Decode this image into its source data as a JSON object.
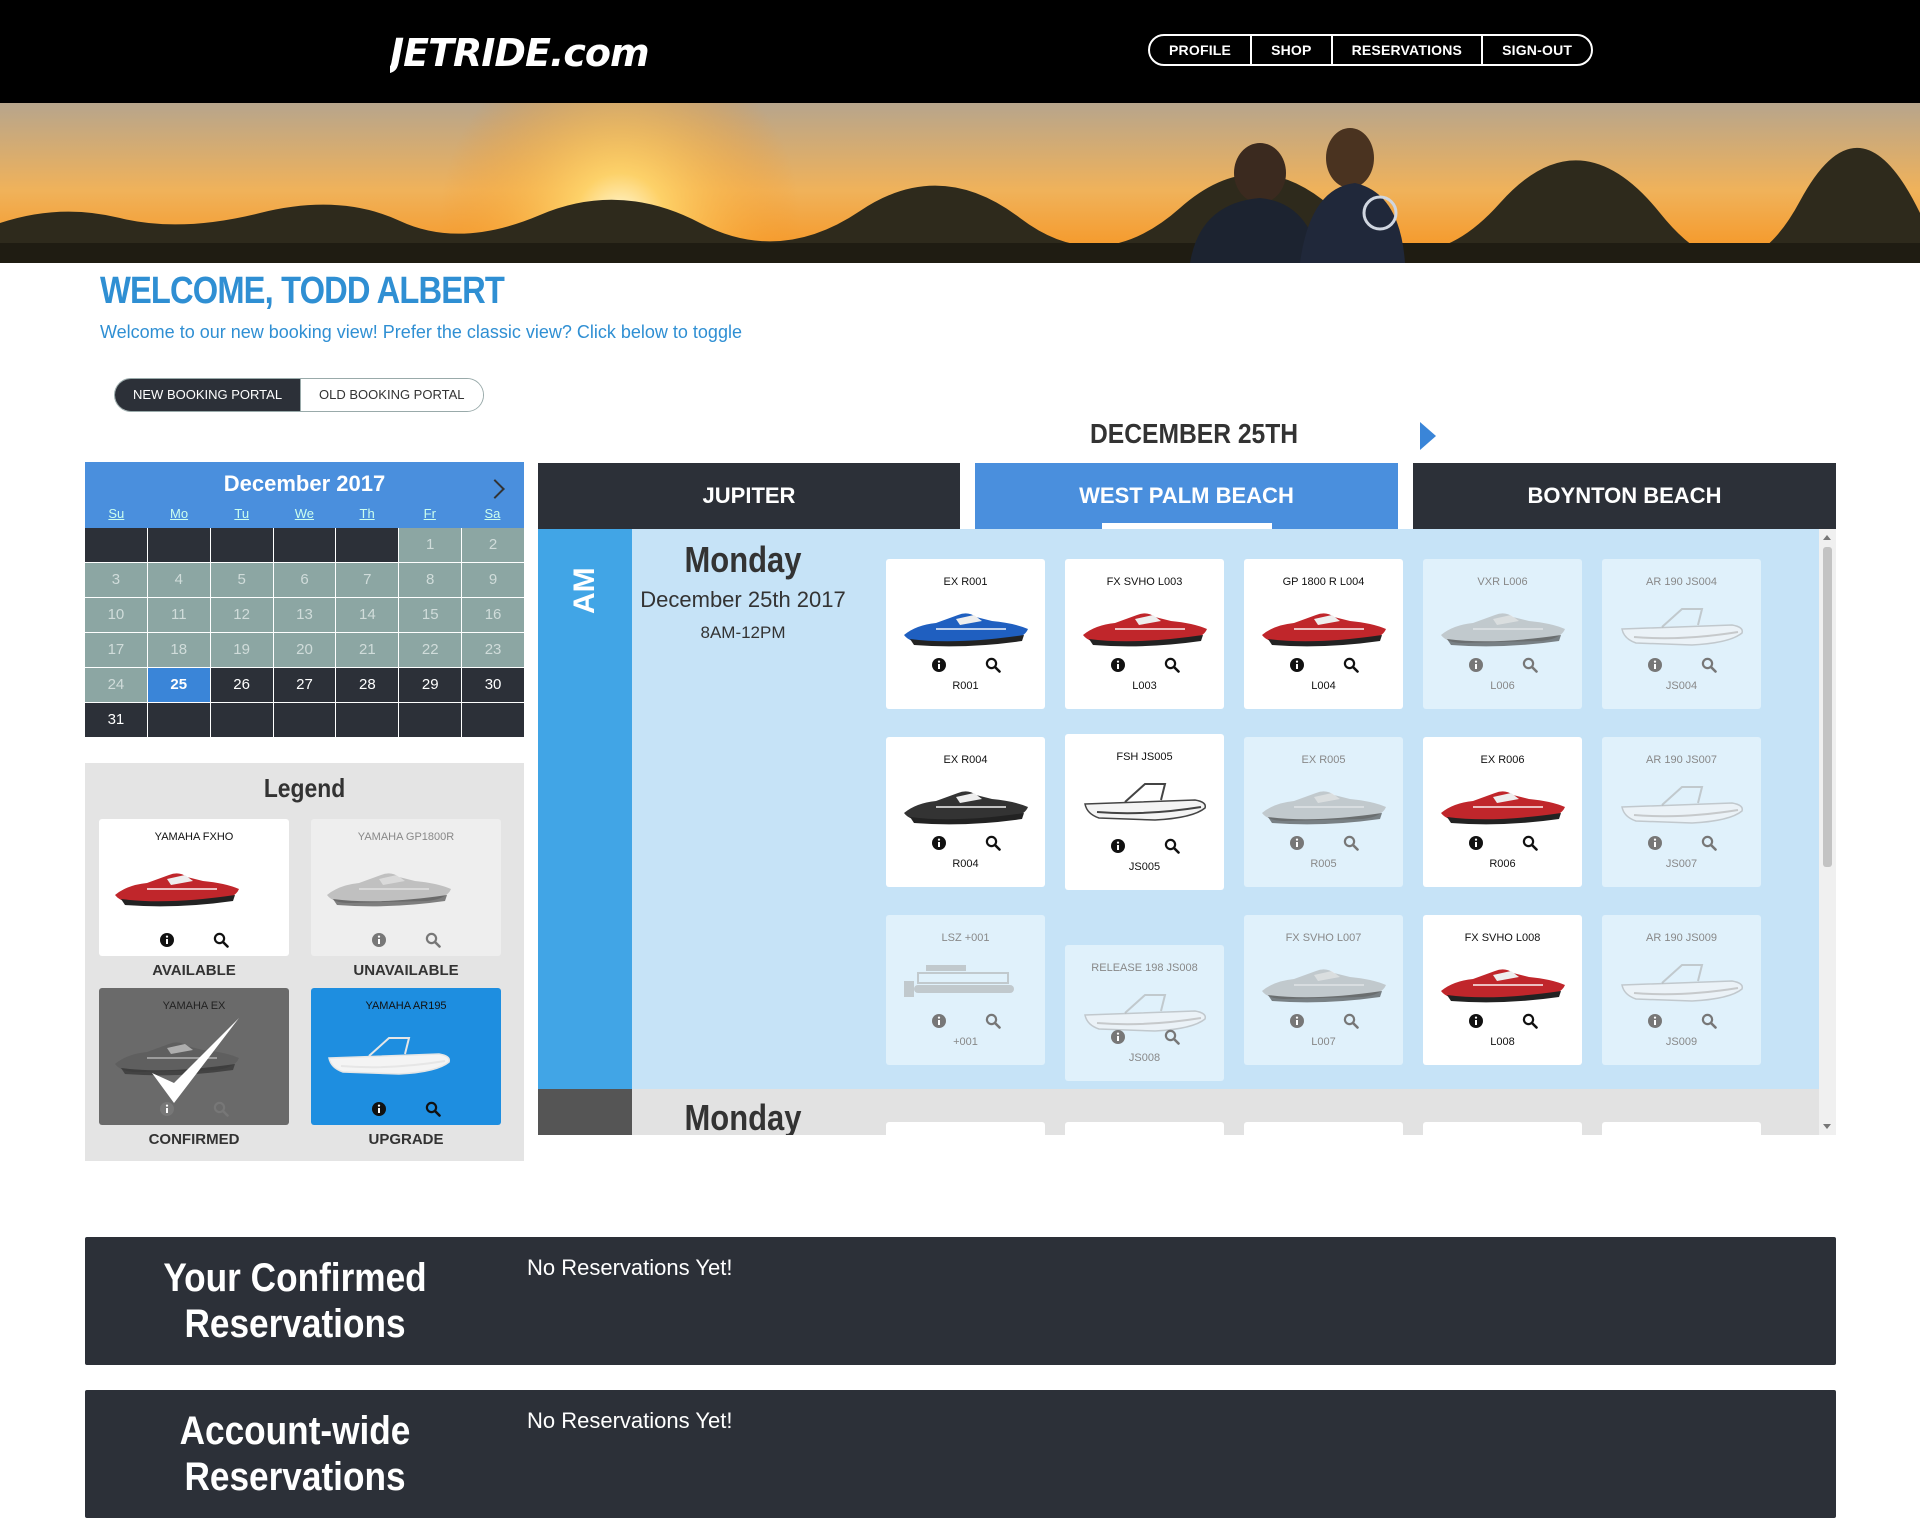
{
  "header": {
    "logo_text": "JETRIDE.com",
    "nav": [
      "PROFILE",
      "SHOP",
      "RESERVATIONS",
      "SIGN-OUT"
    ]
  },
  "welcome": {
    "title": "WELCOME, TODD ALBERT",
    "subtitle": "Welcome to our new booking view! Prefer the classic view? Click below to toggle"
  },
  "portal_toggle": {
    "new": "NEW BOOKING PORTAL",
    "old": "OLD BOOKING PORTAL",
    "selected": "new"
  },
  "date_heading": "DECEMBER 25TH",
  "calendar": {
    "month": "December 2017",
    "weekdays": [
      "Su",
      "Mo",
      "Tu",
      "We",
      "Th",
      "Fr",
      "Sa"
    ],
    "cells": [
      {
        "d": "",
        "s": "empty"
      },
      {
        "d": "",
        "s": "empty"
      },
      {
        "d": "",
        "s": "empty"
      },
      {
        "d": "",
        "s": "empty"
      },
      {
        "d": "",
        "s": "empty"
      },
      {
        "d": "1",
        "s": "past"
      },
      {
        "d": "2",
        "s": "past"
      },
      {
        "d": "3",
        "s": "past"
      },
      {
        "d": "4",
        "s": "past"
      },
      {
        "d": "5",
        "s": "past"
      },
      {
        "d": "6",
        "s": "past"
      },
      {
        "d": "7",
        "s": "past"
      },
      {
        "d": "8",
        "s": "past"
      },
      {
        "d": "9",
        "s": "past"
      },
      {
        "d": "10",
        "s": "past"
      },
      {
        "d": "11",
        "s": "past"
      },
      {
        "d": "12",
        "s": "past"
      },
      {
        "d": "13",
        "s": "past"
      },
      {
        "d": "14",
        "s": "past"
      },
      {
        "d": "15",
        "s": "past"
      },
      {
        "d": "16",
        "s": "past"
      },
      {
        "d": "17",
        "s": "past"
      },
      {
        "d": "18",
        "s": "past"
      },
      {
        "d": "19",
        "s": "past"
      },
      {
        "d": "20",
        "s": "past"
      },
      {
        "d": "21",
        "s": "past"
      },
      {
        "d": "22",
        "s": "past"
      },
      {
        "d": "23",
        "s": "past"
      },
      {
        "d": "24",
        "s": "past"
      },
      {
        "d": "25",
        "s": "today"
      },
      {
        "d": "26",
        "s": "future"
      },
      {
        "d": "27",
        "s": "future"
      },
      {
        "d": "28",
        "s": "future"
      },
      {
        "d": "29",
        "s": "future"
      },
      {
        "d": "30",
        "s": "future"
      },
      {
        "d": "31",
        "s": "future"
      },
      {
        "d": "",
        "s": "empty"
      },
      {
        "d": "",
        "s": "empty"
      },
      {
        "d": "",
        "s": "empty"
      },
      {
        "d": "",
        "s": "empty"
      },
      {
        "d": "",
        "s": "empty"
      },
      {
        "d": "",
        "s": "empty"
      }
    ]
  },
  "legend": {
    "title": "Legend",
    "items": [
      {
        "model": "YAMAHA FXHO",
        "caption": "AVAILABLE",
        "state": "available",
        "color": "#c0262b"
      },
      {
        "model": "YAMAHA GP1800R",
        "caption": "UNAVAILABLE",
        "state": "unavailable",
        "color": "#9a9a9a"
      },
      {
        "model": "YAMAHA EX",
        "caption": "CONFIRMED",
        "state": "confirmed",
        "color": "#555555"
      },
      {
        "model": "YAMAHA AR195",
        "caption": "UPGRADE",
        "state": "upgrade",
        "color": "#e6e6e6"
      }
    ]
  },
  "locations": [
    "JUPITER",
    "WEST PALM BEACH",
    "BOYNTON BEACH"
  ],
  "active_location": "WEST PALM BEACH",
  "slot_am": {
    "label": "AM",
    "day": "Monday",
    "date": "December 25th 2017",
    "hours": "8AM-12PM"
  },
  "slot_pm": {
    "day": "Monday"
  },
  "units": [
    {
      "code": "EX R001",
      "sub": "R001",
      "type": "ski",
      "color": "#1f5fc0",
      "available": true
    },
    {
      "code": "FX SVHO L003",
      "sub": "L003",
      "type": "ski",
      "color": "#c0262b",
      "available": true
    },
    {
      "code": "GP 1800 R L004",
      "sub": "L004",
      "type": "ski",
      "color": "#c0262b",
      "available": true
    },
    {
      "code": "VXR L006",
      "sub": "L006",
      "type": "ski",
      "color": "#a8a8a8",
      "available": false
    },
    {
      "code": "AR 190 JS004",
      "sub": "JS004",
      "type": "boat",
      "color": "#a8a8a8",
      "available": false
    },
    {
      "code": "EX R004",
      "sub": "R004",
      "type": "ski",
      "color": "#333333",
      "available": true
    },
    {
      "code": "FSH JS005",
      "sub": "JS005",
      "type": "boat",
      "color": "#444444",
      "available": true
    },
    {
      "code": "EX R005",
      "sub": "R005",
      "type": "ski",
      "color": "#a8a8a8",
      "available": false
    },
    {
      "code": "EX R006",
      "sub": "R006",
      "type": "ski",
      "color": "#c0262b",
      "available": true
    },
    {
      "code": "AR 190 JS007",
      "sub": "JS007",
      "type": "boat",
      "color": "#a8a8a8",
      "available": false
    },
    {
      "code": "LSZ +001",
      "sub": "+001",
      "type": "pontoon",
      "color": "#a8a8a8",
      "available": false
    },
    {
      "code": "RELEASE 198 JS008",
      "sub": "JS008",
      "type": "boat",
      "color": "#a8a8a8",
      "available": false
    },
    {
      "code": "FX SVHO L007",
      "sub": "L007",
      "type": "ski",
      "color": "#a8a8a8",
      "available": false
    },
    {
      "code": "FX SVHO L008",
      "sub": "L008",
      "type": "ski",
      "color": "#c0262b",
      "available": true
    },
    {
      "code": "AR 190 JS009",
      "sub": "JS009",
      "type": "boat",
      "color": "#a8a8a8",
      "available": false
    }
  ],
  "reservations": {
    "confirmed_title": "Your Confirmed Reservations",
    "confirmed_msg": "No Reservations Yet!",
    "account_title": "Account-wide Reservations",
    "account_msg": "No Reservations Yet!"
  },
  "colors": {
    "brand_blue": "#2f8fd3",
    "active_tab": "#4a8fdd",
    "dark": "#2c3038",
    "am_rail": "#41a5e6",
    "am_bg": "#c6e3f7"
  }
}
